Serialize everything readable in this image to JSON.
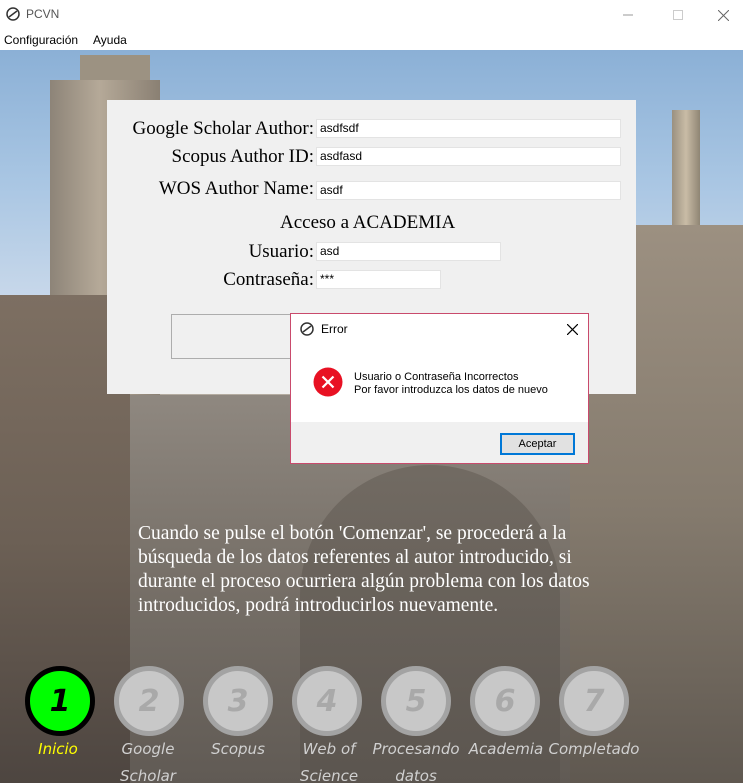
{
  "window": {
    "title": "PCVN"
  },
  "menu": {
    "items": [
      "Configuración",
      "Ayuda"
    ]
  },
  "form": {
    "google_label": "Google Scholar Author:",
    "google_value": "asdfsdf",
    "scopus_label": "Scopus Author ID:",
    "scopus_value": "asdfasd",
    "wos_label": "WOS Author Name:",
    "wos_value": "asdf",
    "academia_title": "Acceso a ACADEMIA",
    "user_label": "Usuario:",
    "user_value": "asd",
    "password_label": "Contraseña:",
    "password_value": "***"
  },
  "dialog": {
    "title": "Error",
    "message_line1": "Usuario o Contraseña Incorrectos",
    "message_line2": "Por favor introduzca los datos de nuevo",
    "ok_label": "Aceptar"
  },
  "description": {
    "lines": [
      "Cuando se pulse el botón 'Comenzar', se procederá a la",
      "búsqueda de los datos referentes al autor introducido, si",
      "durante el proceso ocurriera algún problema con los datos",
      "introducidos, podrá introducirlos nuevamente."
    ]
  },
  "steps": [
    {
      "number": "1",
      "label_lines": [
        "Inicio"
      ],
      "active": true
    },
    {
      "number": "2",
      "label_lines": [
        "Google",
        "Scholar"
      ],
      "active": false
    },
    {
      "number": "3",
      "label_lines": [
        "Scopus"
      ],
      "active": false
    },
    {
      "number": "4",
      "label_lines": [
        "Web of",
        "Science"
      ],
      "active": false
    },
    {
      "number": "5",
      "label_lines": [
        "Procesando",
        "datos"
      ],
      "active": false
    },
    {
      "number": "6",
      "label_lines": [
        "Academia"
      ],
      "active": false
    },
    {
      "number": "7",
      "label_lines": [
        "Completado"
      ],
      "active": false
    }
  ],
  "colors": {
    "active_step_fill": "#00ff00",
    "active_step_label": "#ffff00",
    "inactive_step": "#c8c8c8",
    "dialog_border": "#c94a6c",
    "error_icon": "#e81123"
  }
}
